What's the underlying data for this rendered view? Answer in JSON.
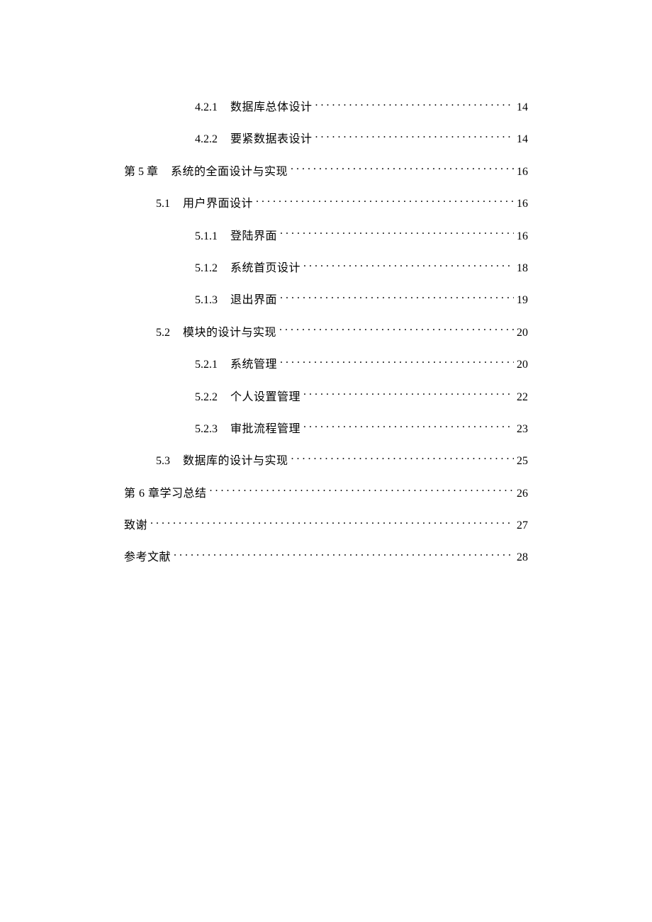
{
  "toc": {
    "entries": [
      {
        "level": 3,
        "number": "4.2.1",
        "title": "数据库总体设计",
        "page": "14"
      },
      {
        "level": 3,
        "number": "4.2.2",
        "title": "要紧数据表设计",
        "page": "14"
      },
      {
        "level": 1,
        "number": "第 5 章",
        "title": "系统的全面设计与实现",
        "page": "16"
      },
      {
        "level": 2,
        "number": "5.1",
        "title": "用户界面设计",
        "page": "16"
      },
      {
        "level": 3,
        "number": "5.1.1",
        "title": "登陆界面",
        "page": "16"
      },
      {
        "level": 3,
        "number": "5.1.2",
        "title": "系统首页设计",
        "page": "18"
      },
      {
        "level": 3,
        "number": "5.1.3",
        "title": "退出界面",
        "page": "19"
      },
      {
        "level": 2,
        "number": "5.2",
        "title": "模块的设计与实现",
        "page": "20"
      },
      {
        "level": 3,
        "number": "5.2.1",
        "title": "系统管理",
        "page": "20"
      },
      {
        "level": 3,
        "number": "5.2.2",
        "title": "个人设置管理",
        "page": "22"
      },
      {
        "level": 3,
        "number": "5.2.3",
        "title": "审批流程管理",
        "page": "23"
      },
      {
        "level": 2,
        "number": "5.3",
        "title": "数据库的设计与实现",
        "page": "25"
      },
      {
        "level": 0,
        "number": "",
        "title": "第 6 章学习总结",
        "page": "26"
      },
      {
        "level": 0,
        "number": "",
        "title": "致谢",
        "page": "27"
      },
      {
        "level": 0,
        "number": "",
        "title": "参考文献",
        "page": "28"
      }
    ]
  }
}
